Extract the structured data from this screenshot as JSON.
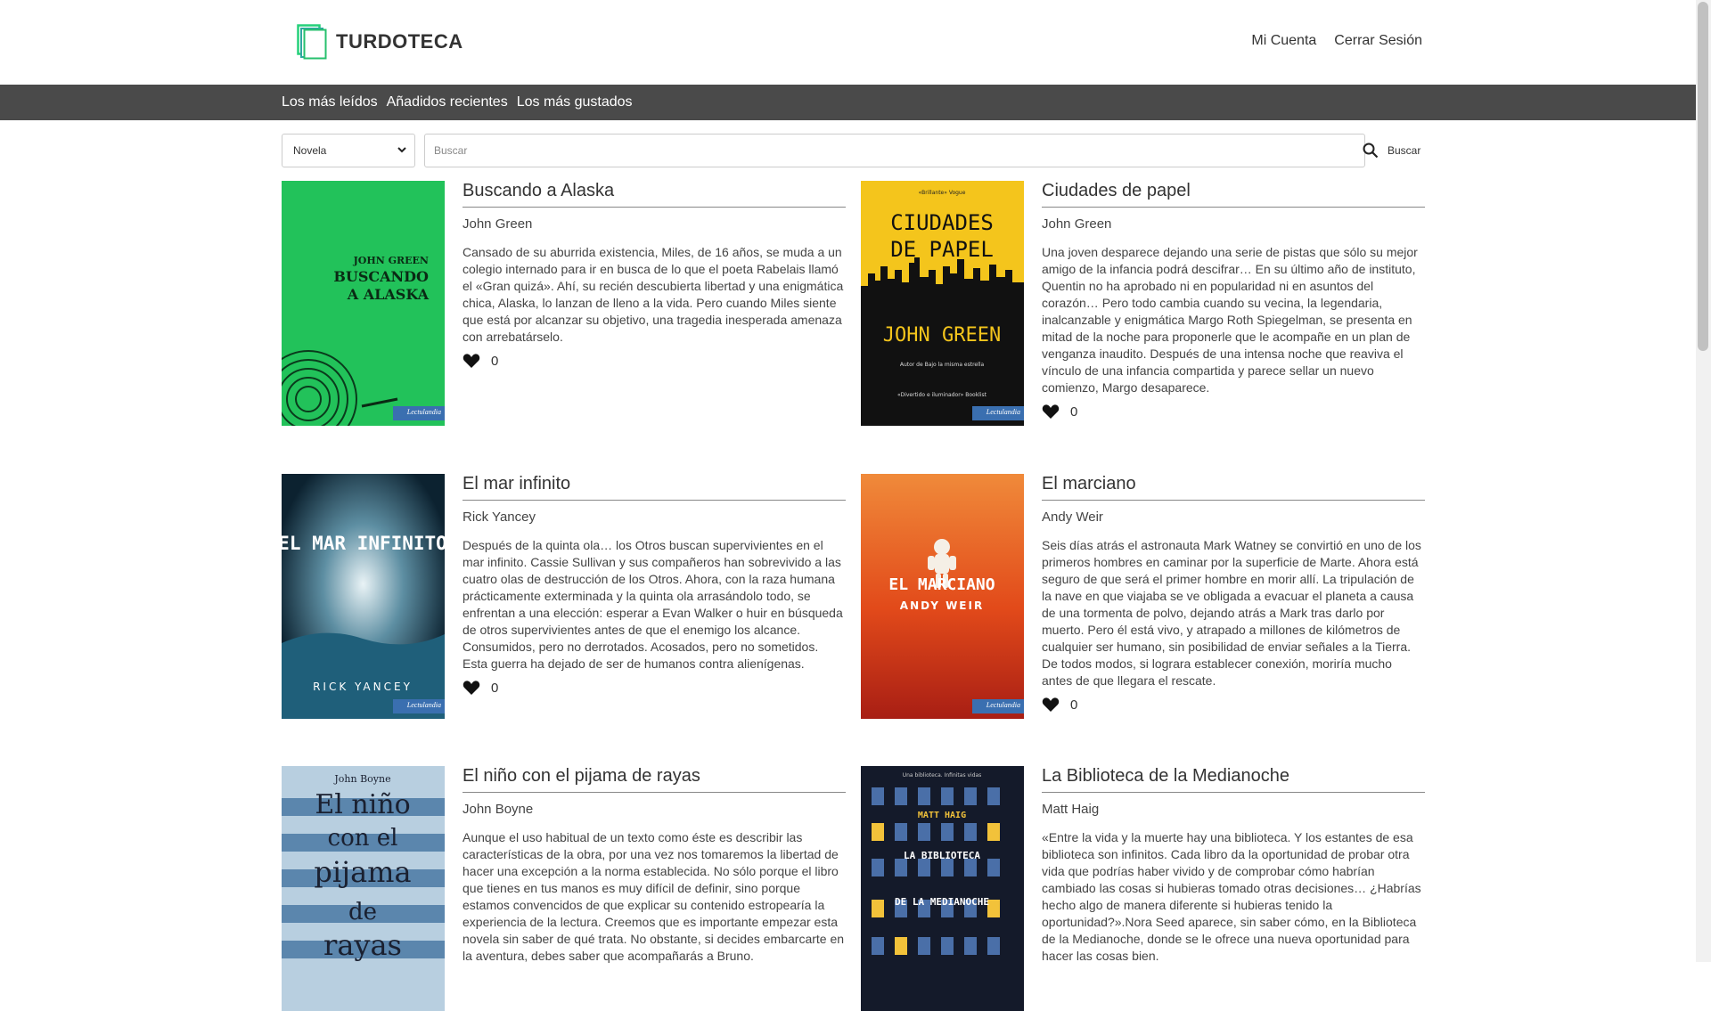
{
  "brand": {
    "name": "TURDOTECA",
    "logo_icon": "stacked-books-logo",
    "accent": "#25d07a"
  },
  "account_nav": {
    "my_account": "Mi Cuenta",
    "logout": "Cerrar Sesión"
  },
  "category_nav": [
    "Los más leídos",
    "Añadidos recientes",
    "Los más gustados"
  ],
  "search": {
    "genre_selected": "Novela",
    "placeholder": "Buscar",
    "button_label": "Buscar"
  },
  "books": [
    {
      "title": "Buscando a Alaska",
      "author": "John Green",
      "description": "Cansado de su aburrida existencia, Miles, de 16 años, se muda a un colegio internado para ir en busca de lo que el poeta Rabelais llamó el «Gran quizá». Ahí, su recién descubierta libertad y una enigmática chica, Alaska, lo lanzan de lleno a la vida. Pero cuando Miles siente que está por alcanzar su objetivo, una tragedia inesperada amenaza con arrebatárselo.",
      "likes": "0",
      "cover": {
        "lines": [
          "JOHN GREEN",
          "BUSCANDO",
          "A ALASKA"
        ],
        "badge": "Lectulandia",
        "bg": "#22c25a"
      }
    },
    {
      "title": "Ciudades de papel",
      "author": "John Green",
      "description": "Una joven desparece dejando una serie de pistas que sólo su mejor amigo de la infancia podrá descifrar… En su último año de instituto, Quentin no ha aprobado ni en popularidad ni en asuntos del corazón… Pero todo cambia cuando su vecina, la legendaria, inalcanzable y enigmática Margo Roth Spiegelman, se presenta en mitad de la noche para proponerle que le acompañe en un plan de venganza inaudito. Después de una intensa noche que reaviva el vínculo de una infancia compartida y parece sellar un nuevo comienzo, Margo desaparece.",
      "likes": "0",
      "cover": {
        "top": "«Brillante» Vogue",
        "lines": [
          "CIUDADES",
          "DE PAPEL"
        ],
        "author": "JOHN GREEN",
        "sub1": "Autor de Bajo la misma estrella",
        "sub2": "«Divertido e iluminador» Booklist",
        "badge": "Lectulandia",
        "bg": "#f4c51c"
      }
    },
    {
      "title": "El mar infinito",
      "author": "Rick Yancey",
      "description": "Después de la quinta ola… los Otros buscan supervivientes en el mar infinito. Cassie Sullivan y sus compañeros han sobrevivido a las cuatro olas de destrucción de los Otros. Ahora, con la raza humana prácticamente exterminada y la quinta ola arrasándolo todo, se enfrentan a una elección: esperar a Evan Walker o huir en búsqueda de otros supervivientes antes de que el enemigo los alcance. Consumidos, pero no derrotados. Acosados, pero no sometidos. Esta guerra ha dejado de ser de humanos contra alienígenas.",
      "likes": "0",
      "cover": {
        "lines": [
          "EL MAR INFINITO"
        ],
        "author": "RICK YANCEY",
        "badge": "Lectulandia",
        "bg": "#16384a"
      }
    },
    {
      "title": "El marciano",
      "author": "Andy Weir",
      "description": "Seis días atrás el astronauta Mark Watney se convirtió en uno de los primeros hombres en caminar por la superficie de Marte. Ahora está seguro de que será el primer hombre en morir allí. La tripulación de la nave en que viajaba se ve obligada a evacuar el planeta a causa de una tormenta de polvo, dejando atrás a Mark tras darlo por muerto. Pero él está vivo, y atrapado a millones de kilómetros de cualquier ser humano, sin posibilidad de enviar señales a la Tierra. De todos modos, si lograra establecer conexión, moriría mucho antes de que llegara el rescate.",
      "likes": "0",
      "cover": {
        "lines": [
          "EL MARCIANO"
        ],
        "author": "ANDY WEIR",
        "badge": "Lectulandia",
        "bg": "#e2561c"
      }
    },
    {
      "title": "El niño con el pijama de rayas",
      "author": "John Boyne",
      "description": "Aunque el uso habitual de un texto como éste es describir las características de la obra, por una vez nos tomaremos la libertad de hacer una excepción a la norma establecida. No sólo porque el libro que tienes en tus manos es muy difícil de definir, sino porque estamos convencidos de que explicar su contenido estropearía la experiencia de la lectura. Creemos que es importante empezar esta novela sin saber de qué trata. No obstante, si decides embarcarte en la aventura, debes saber que acompañarás a Bruno.",
      "likes": "0",
      "cover": {
        "top": "John Boyne",
        "lines": [
          "El niño",
          "con el",
          "pijama",
          "de",
          "rayas"
        ],
        "bg": "#b8cfe0"
      }
    },
    {
      "title": "La Biblioteca de la Medianoche",
      "author": "Matt Haig",
      "description": "«Entre la vida y la muerte hay una biblioteca. Y los estantes de esa biblioteca son infinitos. Cada libro da la oportunidad de probar otra vida que podrías haber vivido y de comprobar cómo habrían cambiado las cosas si hubieras tomado otras decisiones… ¿Habrías hecho algo de manera diferente si hubieras tenido la oportunidad?».Nora Seed aparece, sin saber cómo, en la Biblioteca de la Medianoche, donde se le ofrece una nueva oportunidad para hacer las cosas bien.",
      "likes": "0",
      "cover": {
        "top": "Una biblioteca. Infinitas vidas",
        "author": "MATT HAIG",
        "lines": [
          "LA BIBLIOTECA",
          "DE LA MEDIANOCHE"
        ],
        "bg": "#141a2a"
      }
    }
  ]
}
